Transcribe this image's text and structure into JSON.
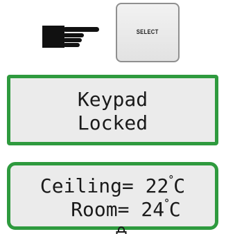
{
  "pointer": {
    "icon": "pointing-hand-icon"
  },
  "select_key": {
    "label": "SELECT"
  },
  "status_display": {
    "line1": "Keypad",
    "line2": "Locked"
  },
  "temperature_display": {
    "ceiling_label": "Ceiling=",
    "ceiling_value": "22",
    "room_label": "Room=",
    "room_value": "24",
    "unit": "C",
    "degree_symbol": "˚",
    "lock_icon": "padlock-icon"
  },
  "colors": {
    "display_border": "#2e9a3e",
    "display_background": "#ebebeb"
  }
}
